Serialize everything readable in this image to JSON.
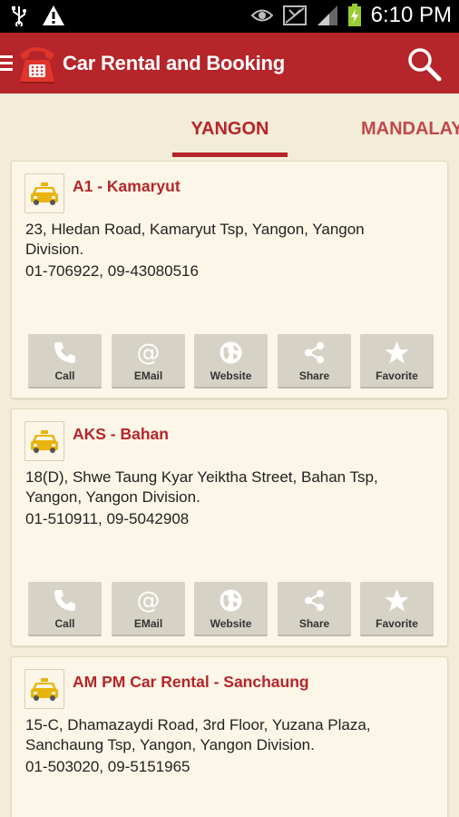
{
  "status_bar": {
    "time": "6:10 PM"
  },
  "app": {
    "title": "Car Rental and Booking"
  },
  "tabs": [
    {
      "label": "YANGON",
      "selected": true
    },
    {
      "label": "MANDALAY",
      "selected": false
    }
  ],
  "listings": [
    {
      "name": "A1 - Kamaryut",
      "address": "23, Hledan Road, Kamaryut Tsp, Yangon, Yangon Division.",
      "phones": "01-706922, 09-43080516"
    },
    {
      "name": "AKS - Bahan",
      "address": "18(D), Shwe Taung Kyar Yeiktha Street, Bahan Tsp, Yangon, Yangon Division.",
      "phones": "01-510911, 09-5042908"
    },
    {
      "name": "AM PM Car Rental - Sanchaung",
      "address": "15-C, Dhamazaydi Road, 3rd Floor, Yuzana Plaza, Sanchaung Tsp, Yangon, Yangon Division.",
      "phones": "01-503020, 09-5151965"
    }
  ],
  "actions": {
    "call": "Call",
    "email": "EMail",
    "website": "Website",
    "share": "Share",
    "favorite": "Favorite"
  },
  "colors": {
    "brand": "#b5252a",
    "background": "#f3ecd8",
    "card": "#fbf6e7",
    "button": "#d6d2c5"
  },
  "icons": [
    "usb-icon",
    "warning-icon",
    "eye-icon",
    "no-signal-icon",
    "cell-signal-icon",
    "battery-icon",
    "menu-icon",
    "telephone-logo-icon",
    "search-icon",
    "taxi-icon",
    "phone-icon",
    "at-icon",
    "globe-icon",
    "share-icon",
    "star-icon"
  ]
}
